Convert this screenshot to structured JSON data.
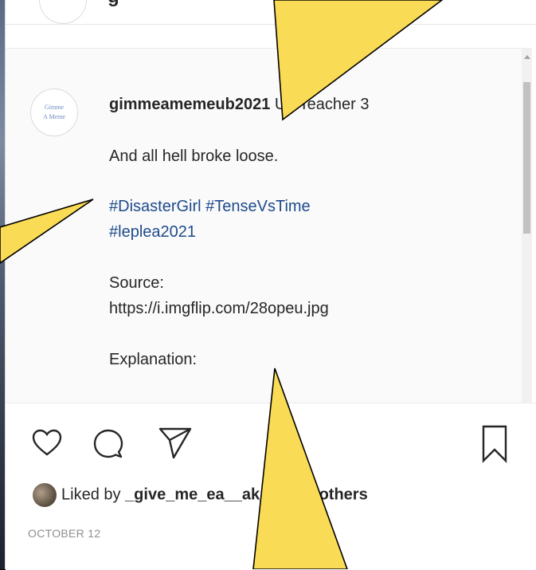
{
  "post": {
    "top_partial_letter": "g",
    "avatar_text_line1": "Gimme",
    "avatar_text_line2": "A Meme",
    "username": "gimmeamemeub2021",
    "username_suffix": " U1 Teacher 3",
    "caption_line1": "And all hell broke loose.",
    "hashtags_line1": "#DisasterGirl #TenseVsTime",
    "hashtags_line2": "#leplea2021",
    "source_label": "Source:",
    "source_url": "https://i.imgflip.com/28opeu.jpg",
    "explanation_label": "Explanation:"
  },
  "actions": {
    "like_icon": "heart-icon",
    "comment_icon": "comment-icon",
    "share_icon": "share-icon",
    "save_icon": "bookmark-icon"
  },
  "likes": {
    "prefix": "Liked by ",
    "user": "_give_me_ea_",
    "middle": "_ak_ and ",
    "others": "3 others"
  },
  "date": "OCTOBER 12",
  "colors": {
    "callout_fill": "#fadb55",
    "hashtag": "#1e4b8c",
    "text": "#262626"
  }
}
